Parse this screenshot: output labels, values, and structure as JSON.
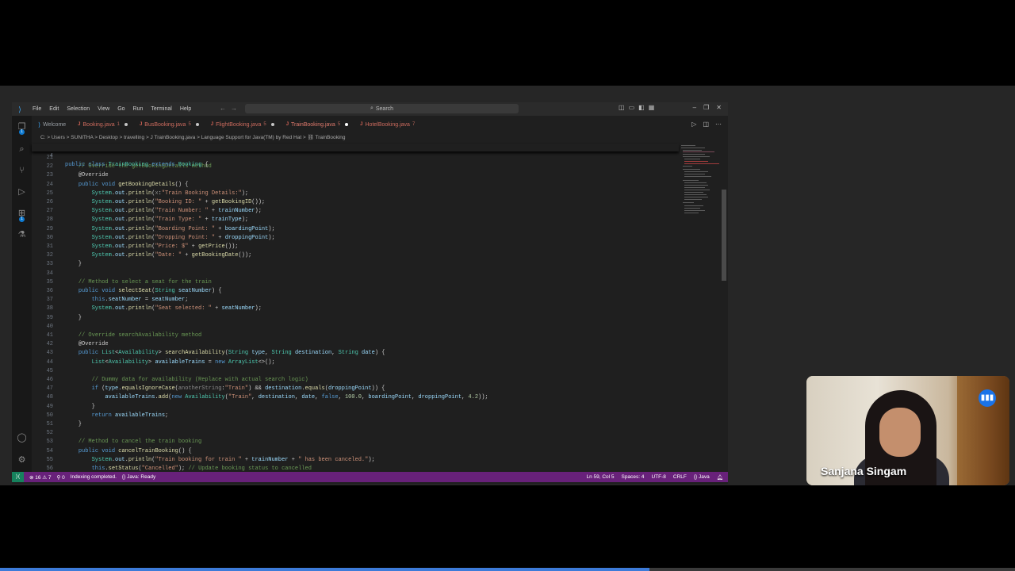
{
  "menu": [
    "File",
    "Edit",
    "Selection",
    "View",
    "Go",
    "Run",
    "Terminal",
    "Help"
  ],
  "search": {
    "label": "Search"
  },
  "tabs": [
    {
      "label": "Welcome",
      "num": "",
      "kind": "welcome",
      "modified": false
    },
    {
      "label": "Booking.java",
      "num": "1",
      "kind": "java",
      "modified": true
    },
    {
      "label": "BusBooking.java",
      "num": "5",
      "kind": "java",
      "modified": true
    },
    {
      "label": "FlightBooking.java",
      "num": "5",
      "kind": "java",
      "modified": true
    },
    {
      "label": "TrainBooking.java",
      "num": "5",
      "kind": "java",
      "modified": true,
      "active": true
    },
    {
      "label": "HotelBooking.java",
      "num": "7",
      "kind": "java",
      "modified": false
    }
  ],
  "breadcrumb": "C: > Users > SUNITHA > Desktop > travelling > J TrainBooking.java > Language Support for Java(TM) by Red Hat > ⛓ TrainBooking",
  "sticky_line": {
    "num": "4",
    "text": "public class TrainBooking extends Booking {"
  },
  "code_lines": [
    {
      "n": "21",
      "t": ""
    },
    {
      "n": "22",
      "t": "    // Override the getBookingDetails method"
    },
    {
      "n": "23",
      "t": "    @Override"
    },
    {
      "n": "24",
      "t": "    public void getBookingDetails() {"
    },
    {
      "n": "25",
      "t": "        System.out.println(x:\"Train Booking Details:\");"
    },
    {
      "n": "26",
      "t": "        System.out.println(\"Booking ID: \" + getBookingID());"
    },
    {
      "n": "27",
      "t": "        System.out.println(\"Train Number: \" + trainNumber);"
    },
    {
      "n": "28",
      "t": "        System.out.println(\"Train Type: \" + trainType);"
    },
    {
      "n": "29",
      "t": "        System.out.println(\"Boarding Point: \" + boardingPoint);"
    },
    {
      "n": "30",
      "t": "        System.out.println(\"Dropping Point: \" + droppingPoint);"
    },
    {
      "n": "31",
      "t": "        System.out.println(\"Price: $\" + getPrice());"
    },
    {
      "n": "32",
      "t": "        System.out.println(\"Date: \" + getBookingDate());"
    },
    {
      "n": "33",
      "t": "    }"
    },
    {
      "n": "34",
      "t": ""
    },
    {
      "n": "35",
      "t": "    // Method to select a seat for the train"
    },
    {
      "n": "36",
      "t": "    public void selectSeat(String seatNumber) {"
    },
    {
      "n": "37",
      "t": "        this.seatNumber = seatNumber;"
    },
    {
      "n": "38",
      "t": "        System.out.println(\"Seat selected: \" + seatNumber);"
    },
    {
      "n": "39",
      "t": "    }"
    },
    {
      "n": "40",
      "t": ""
    },
    {
      "n": "41",
      "t": "    // Override searchAvailability method"
    },
    {
      "n": "42",
      "t": "    @Override"
    },
    {
      "n": "43",
      "t": "    public List<Availability> searchAvailability(String type, String destination, String date) {"
    },
    {
      "n": "44",
      "t": "        List<Availability> availableTrains = new ArrayList<>();"
    },
    {
      "n": "45",
      "t": ""
    },
    {
      "n": "46",
      "t": "        // Dummy data for availability (Replace with actual search logic)"
    },
    {
      "n": "47",
      "t": "        if (type.equalsIgnoreCase(anotherString:\"Train\") && destination.equals(droppingPoint)) {"
    },
    {
      "n": "48",
      "t": "            availableTrains.add(new Availability(\"Train\", destination, date, false, 100.0, boardingPoint, droppingPoint, 4.2));"
    },
    {
      "n": "49",
      "t": "        }"
    },
    {
      "n": "50",
      "t": "        return availableTrains;"
    },
    {
      "n": "51",
      "t": "    }"
    },
    {
      "n": "52",
      "t": ""
    },
    {
      "n": "53",
      "t": "    // Method to cancel the train booking"
    },
    {
      "n": "54",
      "t": "    public void cancelTrainBooking() {"
    },
    {
      "n": "55",
      "t": "        System.out.println(\"Train booking for train \" + trainNumber + \" has been canceled.\");"
    },
    {
      "n": "56",
      "t": "        this.setStatus(\"Cancelled\"); // Update booking status to cancelled"
    }
  ],
  "status": {
    "problems": "⊗ 16 ⚠ 7",
    "ports": "⚲ 0",
    "indexing": "Indexing completed.",
    "java": "{} Java: Ready",
    "position": "Ln 59, Col 5",
    "spaces": "Spaces: 4",
    "encoding": "UTF-8",
    "eol": "CRLF",
    "language": "{} Java"
  },
  "webcam": {
    "name": "Sanjana Singam"
  },
  "video_progress": 0.64,
  "colors": {
    "statusbar": "#68217a",
    "accent": "#3ea6f4"
  }
}
